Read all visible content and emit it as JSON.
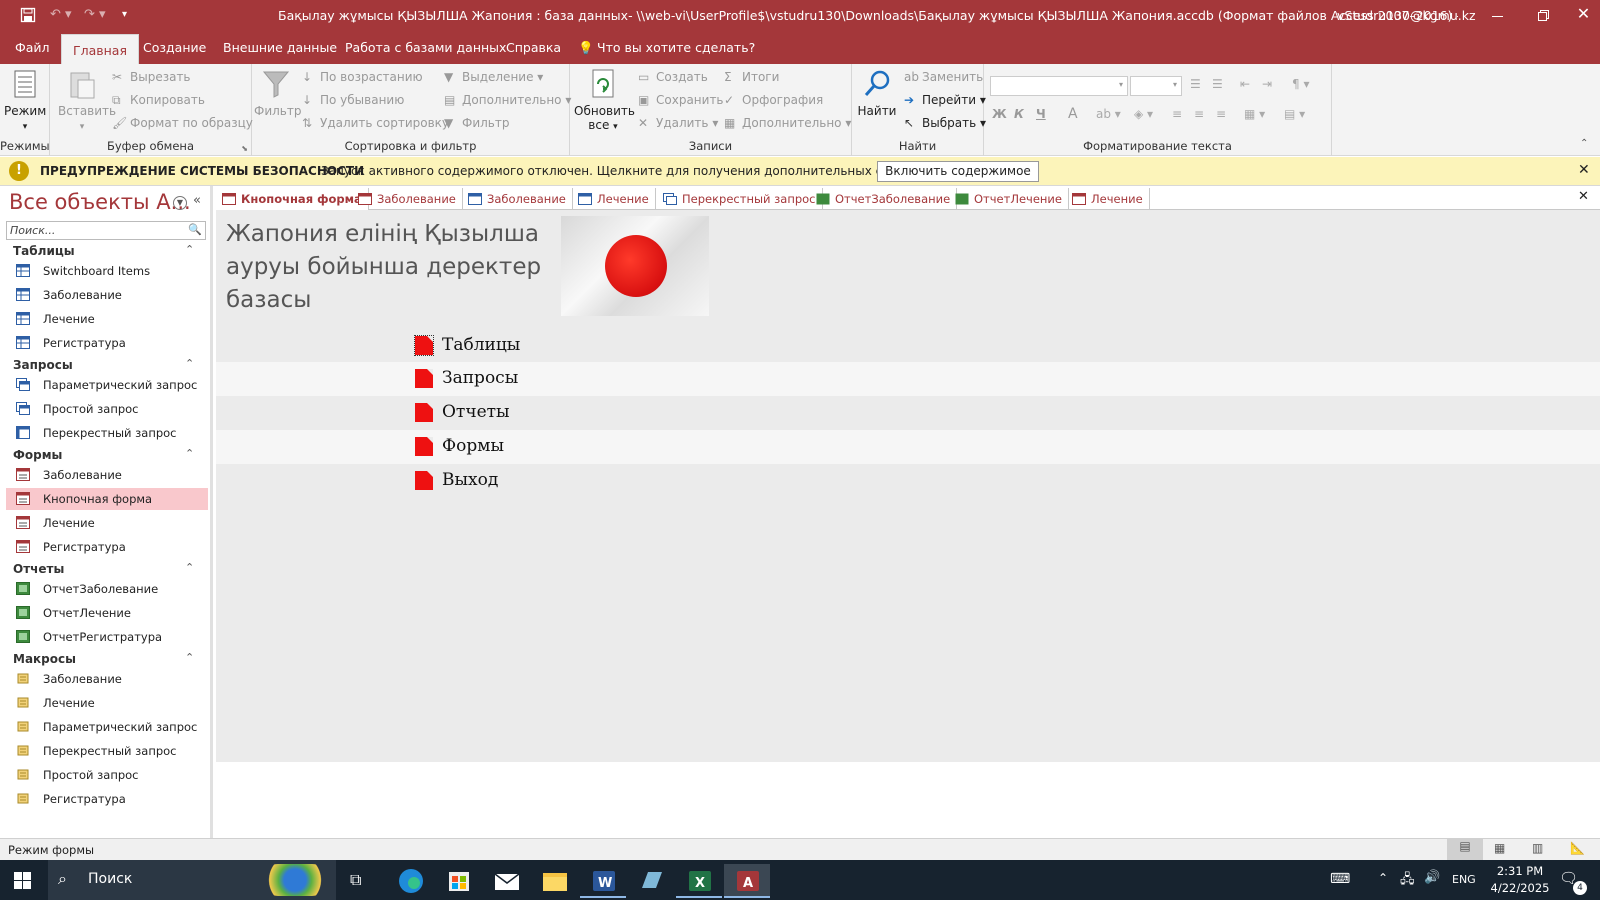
{
  "titlebar": {
    "title": "Бақылау жұмысы ҚЫЗЫЛША Жапония : база данных- \\\\web-vi\\UserProfile$\\vstudru130\\Downloads\\Бақылау жұмысы ҚЫЗЫЛША Жапония.accdb (Формат файлов Access 2007–2016)  -  Access",
    "user": "vStudru130@kgmu.kz"
  },
  "ribbon_tabs": [
    "Файл",
    "Главная",
    "Создание",
    "Внешние данные",
    "Работа с базами данных",
    "Справка",
    "Что вы хотите сделать?"
  ],
  "ribbon": {
    "views": {
      "mode": "Режим",
      "label": "Режимы"
    },
    "clipboard": {
      "paste": "Вставить",
      "cut": "Вырезать",
      "copy": "Копировать",
      "format": "Формат по образцу",
      "label": "Буфер обмена"
    },
    "sort": {
      "filter": "Фильтр",
      "asc": "По возрастанию",
      "desc": "По убыванию",
      "remove": "Удалить сортировку",
      "selection": "Выделение",
      "advanced": "Дополнительно",
      "toggle": "Фильтр",
      "label": "Сортировка и фильтр"
    },
    "records": {
      "refresh": "Обновить все",
      "create": "Создать",
      "save": "Сохранить",
      "delete": "Удалить",
      "totals": "Итоги",
      "spelling": "Орфография",
      "more": "Дополнительно",
      "label": "Записи"
    },
    "find": {
      "find": "Найти",
      "replace": "Заменить",
      "goto": "Перейти",
      "select": "Выбрать",
      "label": "Найти"
    },
    "textformat": {
      "bold": "Ж",
      "italic": "К",
      "underline": "Ч",
      "fontcolor": "A",
      "label": "Форматирование текста"
    }
  },
  "security": {
    "title": "ПРЕДУПРЕЖДЕНИЕ СИСТЕМЫ БЕЗОПАСНОСТИ",
    "message": "Запуск активного содержимого отключен. Щелкните для получения дополнительных сведений.",
    "button": "Включить содержимое"
  },
  "nav": {
    "title": "Все объекты А...",
    "search_placeholder": "Поиск...",
    "sections": [
      {
        "name": "Таблицы",
        "items": [
          "Switchboard Items",
          "Заболевание",
          "Лечение",
          "Регистратура"
        ]
      },
      {
        "name": "Запросы",
        "items": [
          "Параметрический запрос",
          "Простой запрос",
          "Перекрестный запрос"
        ]
      },
      {
        "name": "Формы",
        "items": [
          "Заболевание",
          "Кнопочная форма",
          "Лечение",
          "Регистратура"
        ]
      },
      {
        "name": "Отчеты",
        "items": [
          "ОтчетЗаболевание",
          "ОтчетЛечение",
          "ОтчетРегистратура"
        ]
      },
      {
        "name": "Макросы",
        "items": [
          "Заболевание",
          "Лечение",
          "Параметрический запрос",
          "Перекрестный запрос",
          "Простой запрос",
          "Регистратура"
        ]
      }
    ]
  },
  "doc_tabs": [
    "Кнопочная форма",
    "Заболевание",
    "Заболевание",
    "Лечение",
    "Перекрестный запрос",
    "ОтчетЗаболевание",
    "ОтчетЛечение",
    "Лечение"
  ],
  "form": {
    "title": "Жапония елінің Қызылша ауруы бойынша деректер базасы",
    "buttons": [
      "Таблицы",
      "Запросы",
      "Отчеты",
      "Формы",
      "Выход"
    ]
  },
  "status": {
    "mode": "Режим формы"
  },
  "taskbar": {
    "search": "Поиск",
    "lang": "ENG",
    "time": "2:31 PM",
    "date": "4/22/2025",
    "notif": "4"
  },
  "colors": {
    "accent": "#a4373a",
    "security_bg": "#fcf4ba",
    "form_bg": "#ebebeb",
    "selected_nav": "#f9c8cc"
  }
}
